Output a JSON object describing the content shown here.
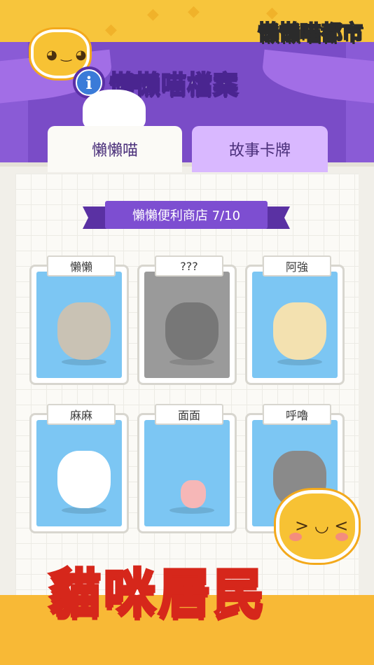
{
  "brand": {
    "logo_text": "懶懶喵都市"
  },
  "header": {
    "title": "懶懶喵檔案",
    "info_icon": "i"
  },
  "tabs": [
    {
      "label": "懶懶喵",
      "active": true
    },
    {
      "label": "故事卡牌",
      "active": false
    }
  ],
  "section": {
    "ribbon_label": "懶懶便利商店 7/10"
  },
  "cards": [
    {
      "name": "懶懶",
      "locked": false,
      "color": "#c9c2b4"
    },
    {
      "name": "???",
      "locked": true,
      "color": "#777777"
    },
    {
      "name": "阿強",
      "locked": false,
      "color": "#f3e1b0"
    },
    {
      "name": "麻麻",
      "locked": false,
      "color": "#ffffff"
    },
    {
      "name": "面面",
      "locked": false,
      "color": "#f6b7b7"
    },
    {
      "name": "呼嚕",
      "locked": false,
      "color": "#8a8a8a"
    }
  ],
  "footer": {
    "headline": "貓咪居民"
  },
  "colors": {
    "accent_purple": "#7d4ed1",
    "card_bg_blue": "#7cc6f3",
    "banner_yellow": "#f7c53c"
  }
}
